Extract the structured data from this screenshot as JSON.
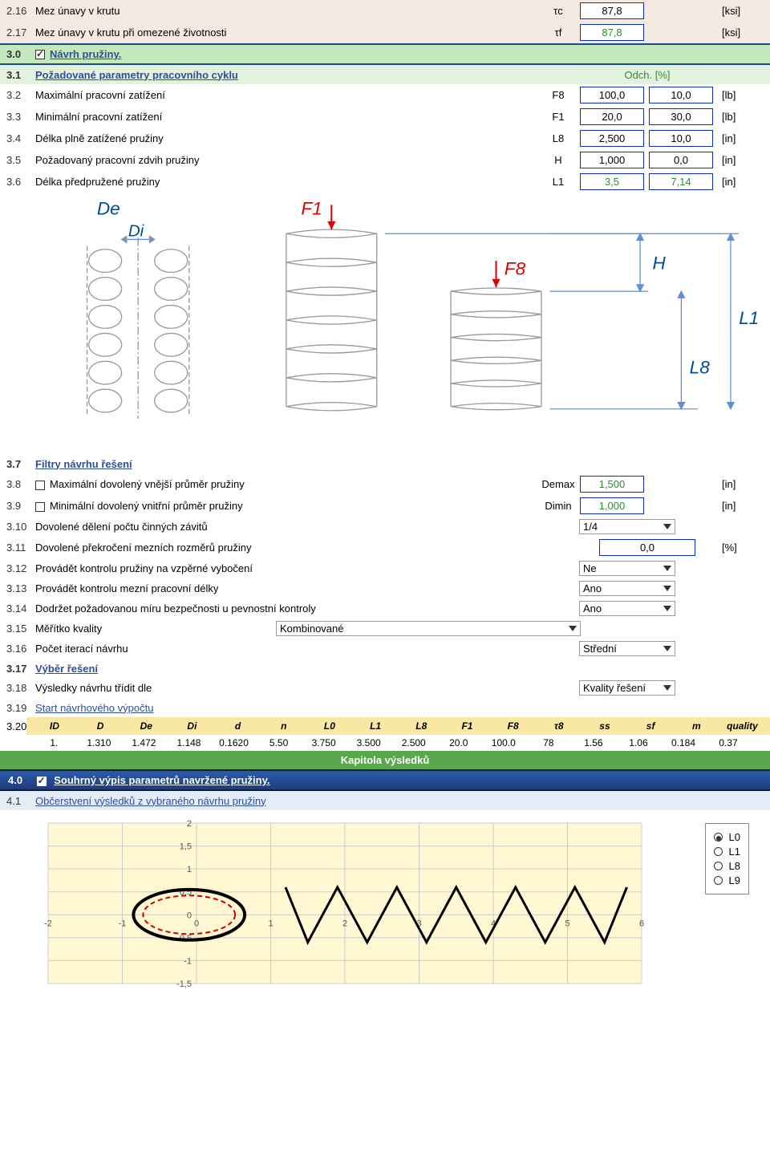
{
  "r216": {
    "num": "2.16",
    "label": "Mez únavy v krutu",
    "sym": "τc",
    "val": "87,8",
    "unit": "[ksi]"
  },
  "r217": {
    "num": "2.17",
    "label": "Mez únavy v krutu při omezené životnosti",
    "sym": "τf",
    "val": "87,8",
    "unit": "[ksi]"
  },
  "r30": {
    "num": "3.0",
    "label": "Návrh pružiny."
  },
  "r31": {
    "num": "3.1",
    "label": "Požadované parametry pracovního cyklu",
    "odch": "Odch. [%]"
  },
  "r32": {
    "num": "3.2",
    "label": "Maximální pracovní zatížení",
    "sym": "F8",
    "v1": "100,0",
    "v2": "10,0",
    "unit": "[lb]"
  },
  "r33": {
    "num": "3.3",
    "label": "Minimální pracovní zatížení",
    "sym": "F1",
    "v1": "20,0",
    "v2": "30,0",
    "unit": "[lb]"
  },
  "r34": {
    "num": "3.4",
    "label": "Délka plně zatížené pružiny",
    "sym": "L8",
    "v1": "2,500",
    "v2": "10,0",
    "unit": "[in]"
  },
  "r35": {
    "num": "3.5",
    "label": "Požadovaný pracovní zdvih pružiny",
    "sym": "H",
    "v1": "1,000",
    "v2": "0,0",
    "unit": "[in]"
  },
  "r36": {
    "num": "3.6",
    "label": "Délka předpružené pružiny",
    "sym": "L1",
    "v1": "3,5",
    "v2": "7,14",
    "unit": "[in]"
  },
  "diag": {
    "De": "De",
    "Di": "Di",
    "F1": "F1",
    "F8": "F8",
    "H": "H",
    "L8": "L8",
    "L1": "L1"
  },
  "r37": {
    "num": "3.7",
    "label": "Filtry návrhu řešení"
  },
  "r38": {
    "num": "3.8",
    "label": "Maximální dovolený vnější průměr pružiny",
    "sym": "Demax",
    "v": "1,500",
    "unit": "[in]"
  },
  "r39": {
    "num": "3.9",
    "label": "Minimální dovolený vnitřní průměr pružiny",
    "sym": "Dimin",
    "v": "1,000",
    "unit": "[in]"
  },
  "r310": {
    "num": "3.10",
    "label": "Dovolené dělení počtu činných závitů",
    "v": "1/4"
  },
  "r311": {
    "num": "3.11",
    "label": "Dovolené překročení mezních rozměrů pružiny",
    "v": "0,0",
    "unit": "[%]"
  },
  "r312": {
    "num": "3.12",
    "label": "Provádět kontrolu pružiny na vzpěrné vybočení",
    "v": "Ne"
  },
  "r313": {
    "num": "3.13",
    "label": "Provádět kontrolu mezní pracovní délky",
    "v": "Ano"
  },
  "r314": {
    "num": "3.14",
    "label": "Dodržet požadovanou míru bezpečnosti u pevnostní kontroly",
    "v": "Ano"
  },
  "r315": {
    "num": "3.15",
    "label": "Měřítko kvality",
    "v": "Kombinované"
  },
  "r316": {
    "num": "3.16",
    "label": "Počet iterací návrhu",
    "v": "Střední"
  },
  "r317": {
    "num": "3.17",
    "label": "Výběr řešení"
  },
  "r318": {
    "num": "3.18",
    "label": "Výsledky návrhu třídit dle",
    "v": "Kvality řešení"
  },
  "r319": {
    "num": "3.19",
    "label": "Start návrhového výpočtu"
  },
  "r320": {
    "num": "3.20"
  },
  "th": {
    "c0": "ID",
    "c1": "D",
    "c2": "De",
    "c3": "Di",
    "c4": "d",
    "c5": "n",
    "c6": "L0",
    "c7": "L1",
    "c8": "L8",
    "c9": "F1",
    "c10": "F8",
    "c11": "τ8",
    "c12": "ss",
    "c13": "sf",
    "c14": "m",
    "c15": "quality"
  },
  "tr": {
    "c0": "1.",
    "c1": "1.310",
    "c2": "1.472",
    "c3": "1.148",
    "c4": "0.1620",
    "c5": "5.50",
    "c6": "3.750",
    "c7": "3.500",
    "c8": "2.500",
    "c9": "20.0",
    "c10": "100.0",
    "c11": "78",
    "c12": "1.56",
    "c13": "1.06",
    "c14": "0.184",
    "c15": "0.37"
  },
  "kap": "Kapitola výsledků",
  "r40": {
    "num": "4.0",
    "label": "Souhrný výpis parametrů navržené pružiny."
  },
  "r41": {
    "num": "4.1",
    "label": "Občerstvení výsledků z vybraného návrhu pružiny"
  },
  "legend": {
    "l0": "L0",
    "l1": "L1",
    "l8": "L8",
    "l9": "L9"
  },
  "chart_data": {
    "type": "line",
    "title": "",
    "xlabel": "",
    "ylabel": "",
    "xlim": [
      -2,
      6
    ],
    "ylim": [
      -1.5,
      2
    ],
    "x_ticks": [
      -2,
      -1,
      0,
      1,
      2,
      3,
      4,
      5,
      6
    ],
    "y_ticks": [
      -1.5,
      -1,
      -0.5,
      0,
      0.5,
      1,
      1.5,
      2
    ],
    "series": [
      {
        "name": "coil-outline",
        "stroke": "#000",
        "fill": "none",
        "shape": "ellipse",
        "cx": -0.1,
        "cy": 0,
        "rx": 0.75,
        "ry": 0.55
      },
      {
        "name": "coil-inner",
        "stroke": "#c00",
        "fill": "none",
        "dash": true,
        "shape": "ellipse",
        "cx": -0.1,
        "cy": 0,
        "rx": 0.62,
        "ry": 0.42
      },
      {
        "name": "spring-zigzag",
        "stroke": "#000",
        "fill": "none",
        "x": [
          1.2,
          1.5,
          1.9,
          2.3,
          2.7,
          3.1,
          3.5,
          3.9,
          4.3,
          4.7,
          5.1,
          5.5,
          5.8
        ],
        "y": [
          0.6,
          -0.6,
          0.6,
          -0.6,
          0.6,
          -0.6,
          0.6,
          -0.6,
          0.6,
          -0.6,
          0.6,
          -0.6,
          0.6
        ]
      }
    ]
  }
}
